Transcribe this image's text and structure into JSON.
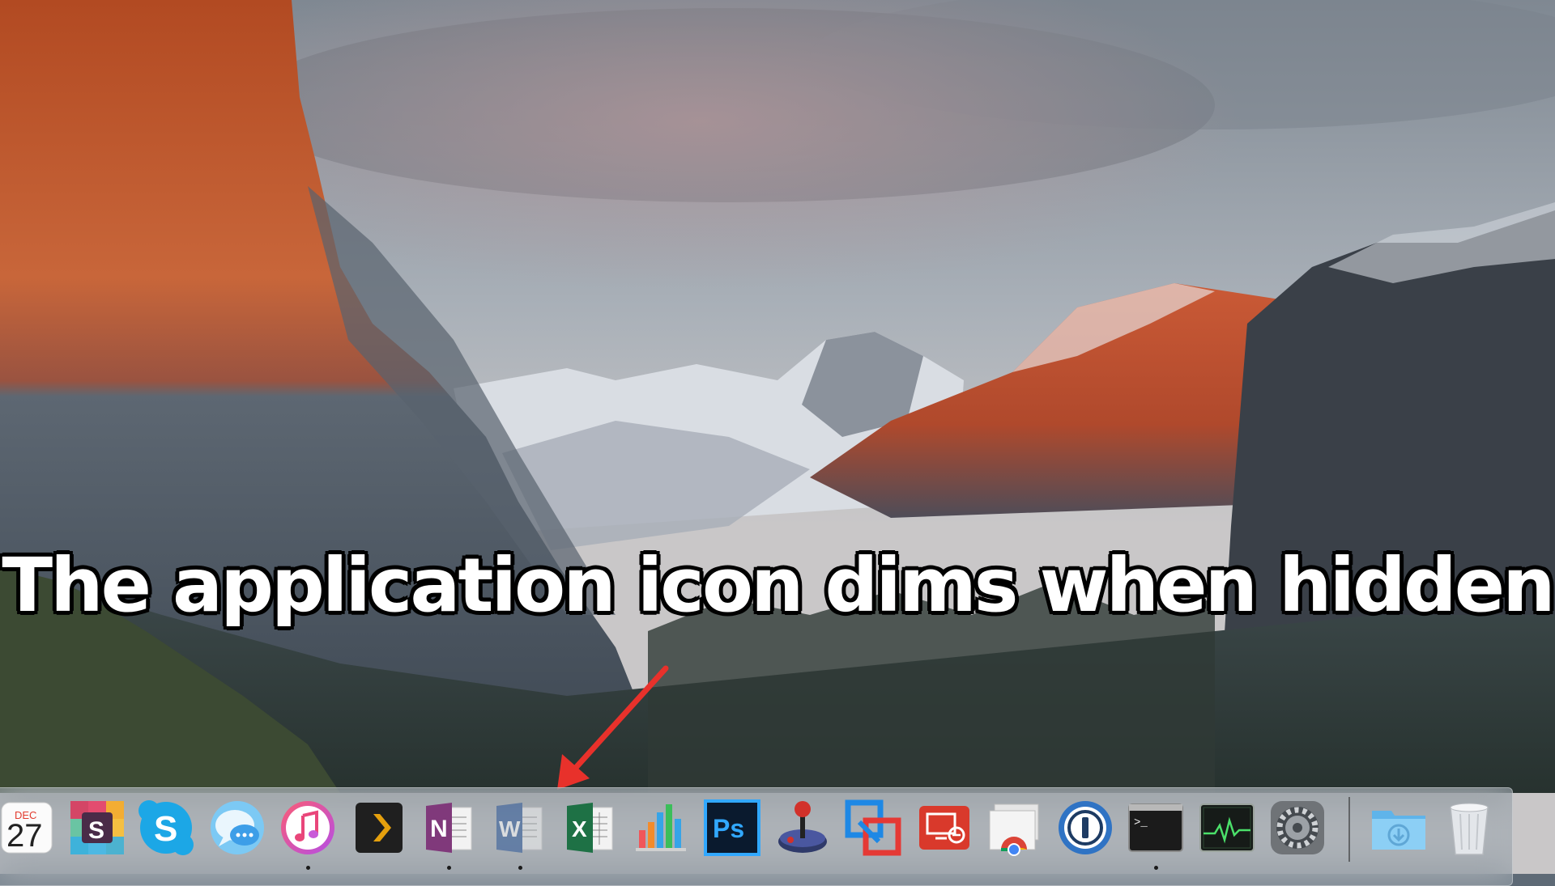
{
  "caption": {
    "text": "The application icon dims when hidden"
  },
  "colors": {
    "arrow": "#e8312b",
    "dock_background": "rgba(150,160,170,0.55)",
    "running_indicator": "#1a1a1a"
  },
  "dock": {
    "calendar": {
      "month": "DEC",
      "day": "27"
    },
    "apps": [
      {
        "name": "Calendar",
        "icon": "calendar-icon",
        "running": false,
        "hidden": false
      },
      {
        "name": "Slack",
        "icon": "slack-icon",
        "running": false,
        "hidden": false
      },
      {
        "name": "Skype",
        "icon": "skype-icon",
        "running": false,
        "hidden": false
      },
      {
        "name": "Messages",
        "icon": "messages-icon",
        "running": false,
        "hidden": false
      },
      {
        "name": "iTunes",
        "icon": "itunes-icon",
        "running": true,
        "hidden": false
      },
      {
        "name": "Plex",
        "icon": "plex-icon",
        "running": false,
        "hidden": false
      },
      {
        "name": "OneNote",
        "icon": "onenote-icon",
        "running": true,
        "hidden": false
      },
      {
        "name": "Word",
        "icon": "word-icon",
        "running": true,
        "hidden": true
      },
      {
        "name": "Excel",
        "icon": "excel-icon",
        "running": false,
        "hidden": false
      },
      {
        "name": "Numbers",
        "icon": "numbers-icon",
        "running": false,
        "hidden": false
      },
      {
        "name": "Photoshop",
        "icon": "photoshop-icon",
        "running": false,
        "hidden": false
      },
      {
        "name": "Arcade",
        "icon": "joystick-icon",
        "running": false,
        "hidden": false
      },
      {
        "name": "VMware",
        "icon": "vmware-icon",
        "running": false,
        "hidden": false
      },
      {
        "name": "Remote Desktop",
        "icon": "remote-desktop-icon",
        "running": false,
        "hidden": false
      },
      {
        "name": "Chrome Apps",
        "icon": "chrome-icon",
        "running": false,
        "hidden": false
      },
      {
        "name": "1Password",
        "icon": "onepassword-icon",
        "running": false,
        "hidden": false
      },
      {
        "name": "Terminal",
        "icon": "terminal-icon",
        "running": true,
        "hidden": false
      },
      {
        "name": "Activity Monitor",
        "icon": "activity-monitor-icon",
        "running": false,
        "hidden": false
      },
      {
        "name": "System Preferences",
        "icon": "gear-icon",
        "running": false,
        "hidden": false
      },
      {
        "name": "Downloads",
        "icon": "downloads-folder-icon",
        "running": false,
        "hidden": false
      },
      {
        "name": "Trash",
        "icon": "trash-icon",
        "running": false,
        "hidden": false
      }
    ],
    "labels": {
      "slack": "S",
      "skype": "S",
      "onenote": "N",
      "word": "W",
      "excel": "X",
      "photoshop": "Ps",
      "terminal": ">_"
    }
  }
}
